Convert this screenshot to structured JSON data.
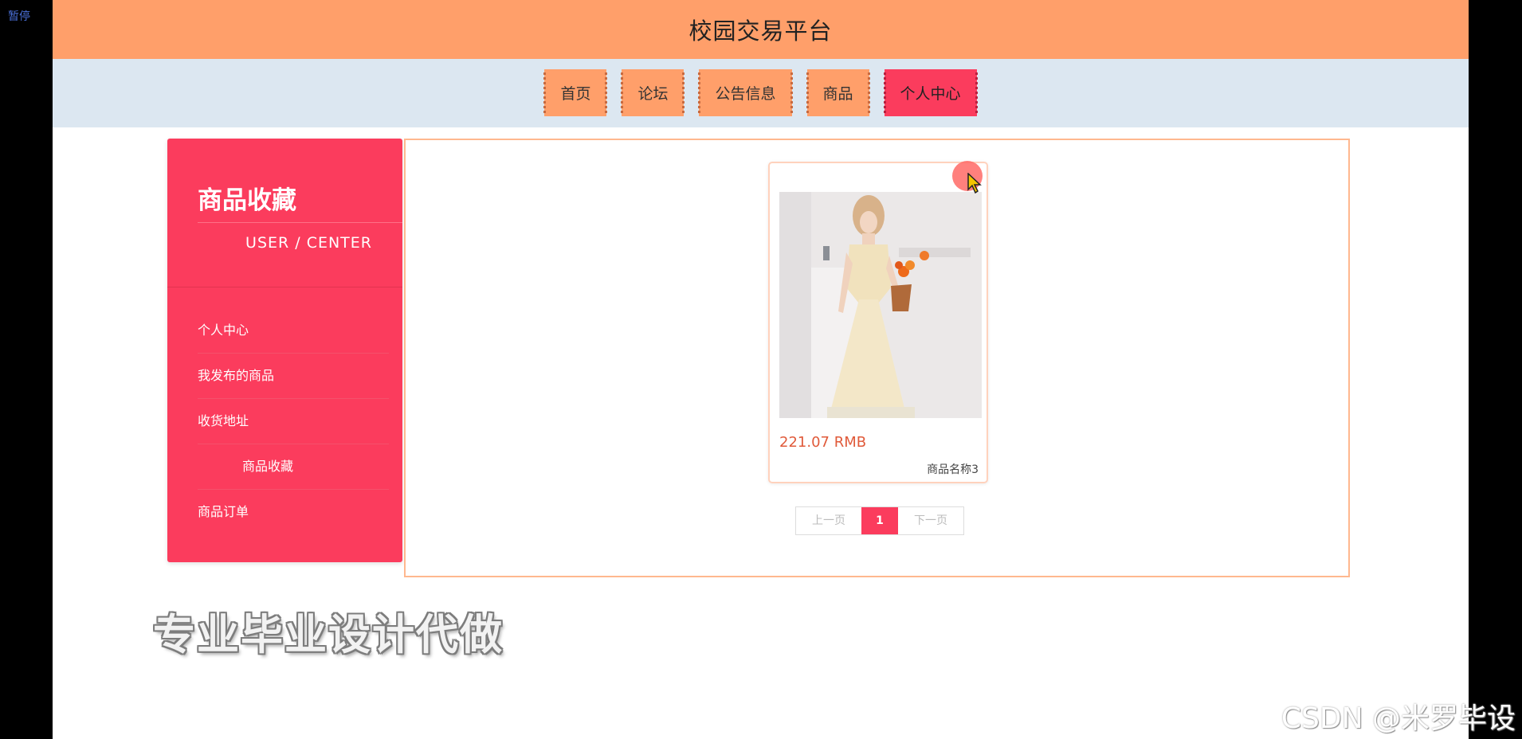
{
  "player": {
    "pause_label": "暂停"
  },
  "header": {
    "title": "校园交易平台"
  },
  "nav": {
    "items": [
      {
        "label": "首页"
      },
      {
        "label": "论坛"
      },
      {
        "label": "公告信息"
      },
      {
        "label": "商品"
      },
      {
        "label": "个人中心"
      }
    ],
    "active_index": 4
  },
  "sidebar": {
    "title": "商品收藏",
    "subtitle": "USER / CENTER",
    "items": [
      {
        "label": "个人中心"
      },
      {
        "label": "我发布的商品"
      },
      {
        "label": "收货地址"
      },
      {
        "label": "商品收藏"
      },
      {
        "label": "商品订单"
      }
    ],
    "active_index": 3
  },
  "products": [
    {
      "price": "221.07 RMB",
      "name": "商品名称3"
    }
  ],
  "pagination": {
    "prev": "上一页",
    "current": "1",
    "next": "下一页"
  },
  "watermark": {
    "text": "专业毕业设计代做"
  },
  "credit": {
    "text": "CSDN @米罗毕设"
  },
  "colors": {
    "header_bg": "#ff9f6a",
    "nav_bg": "#dce7f1",
    "accent": "#fb3c5d",
    "price": "#e05a3a"
  },
  "icons": {
    "cursor": "mouse-pointer-icon",
    "favorite_marker": "favorite-dot-icon"
  }
}
